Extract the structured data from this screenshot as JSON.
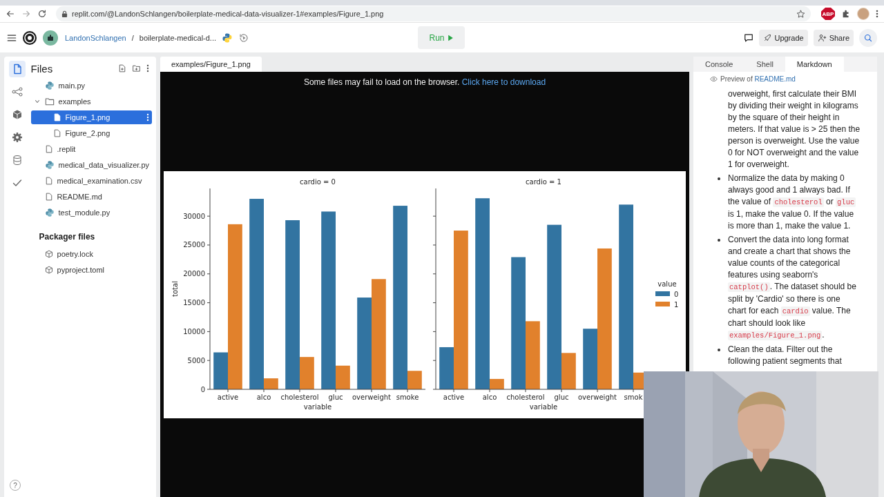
{
  "browser": {
    "url": "replit.com/@LandonSchlangen/boilerplate-medical-data-visualizer-1#examples/Figure_1.png",
    "extension_badge": "ABP"
  },
  "header": {
    "user": "LandonSchlangen",
    "separator": "/",
    "project": "boilerplate-medical-d...",
    "run_button": "Run",
    "upgrade_button": "Upgrade",
    "share_button": "Share"
  },
  "sidebar": {
    "rail": [
      {
        "kind": "files",
        "selected": true
      },
      {
        "kind": "version_control",
        "selected": false
      },
      {
        "kind": "packages",
        "selected": false
      },
      {
        "kind": "settings",
        "selected": false
      },
      {
        "kind": "database",
        "selected": false
      },
      {
        "kind": "tests",
        "selected": false
      }
    ],
    "title": "Files",
    "tree": [
      {
        "name": "main.py",
        "kind": "python",
        "selected": false
      },
      {
        "name": "examples",
        "kind": "folder",
        "selected": false,
        "expanded": true,
        "children": [
          {
            "name": "Figure_1.png",
            "kind": "file",
            "selected": true
          },
          {
            "name": "Figure_2.png",
            "kind": "file",
            "selected": false
          }
        ]
      },
      {
        "name": ".replit",
        "kind": "file",
        "selected": false
      },
      {
        "name": "medical_data_visualizer.py",
        "kind": "python",
        "selected": false
      },
      {
        "name": "medical_examination.csv",
        "kind": "file",
        "selected": false
      },
      {
        "name": "README.md",
        "kind": "file",
        "selected": false
      },
      {
        "name": "test_module.py",
        "kind": "python",
        "selected": false
      }
    ],
    "packager_title": "Packager files",
    "packager_files": [
      {
        "name": "poetry.lock",
        "kind": "package",
        "selected": false
      },
      {
        "name": "pyproject.toml",
        "kind": "package",
        "selected": false
      }
    ],
    "help": "?"
  },
  "editor": {
    "tab": "examples/Figure_1.png",
    "notice": "Some files may fail to load on the browser.",
    "notice_link": "Click here to download",
    "facets": [
      {
        "chart_data": {
          "type": "bar",
          "title": "cardio = 0",
          "xlabel": "variable",
          "ylabel": "total",
          "categories": [
            "active",
            "alco",
            "cholesterol",
            "gluc",
            "overweight",
            "smoke"
          ],
          "ylim": [
            0,
            34800
          ],
          "yticks": [
            0,
            5000,
            10000,
            15000,
            20000,
            25000,
            30000
          ],
          "series": [
            {
              "color": "#3274a1",
              "values": [
                6400,
                33000,
                29300,
                30800,
                15900,
                31800
              ]
            },
            {
              "color": "#e1812c",
              "values": [
                28600,
                1900,
                5600,
                4100,
                19100,
                3200
              ]
            }
          ]
        }
      },
      {
        "chart_data": {
          "type": "bar",
          "title": "cardio = 1",
          "xlabel": "variable",
          "categories": [
            "active",
            "alco",
            "cholesterol",
            "gluc",
            "overweight",
            "smok"
          ],
          "ylim": [
            0,
            34800
          ],
          "legend": {
            "title": "value"
          },
          "series": [
            {
              "name": "0",
              "color": "#3274a1",
              "values": [
                7300,
                33100,
                22900,
                28500,
                10500,
                32000
              ]
            },
            {
              "name": "1",
              "color": "#e1812c",
              "values": [
                27500,
                1800,
                11800,
                6300,
                24400,
                2900
              ]
            }
          ]
        }
      }
    ]
  },
  "right_panel": {
    "tabs": [
      {
        "label": "Console",
        "selected": false
      },
      {
        "label": "Shell",
        "selected": false
      },
      {
        "label": "Markdown",
        "selected": true
      }
    ],
    "preview_label": "Preview of",
    "preview_file": "README.md",
    "items": [
      {
        "kind": "continuation",
        "segments": [
          {
            "kind": "text",
            "text": "overweight, first calculate their BMI by dividing their weight in kilograms by the square of their height in meters. If that value is > 25 then the person is overweight. Use the value 0 for NOT overweight and the value 1 for overweight."
          }
        ]
      },
      {
        "kind": "bullet",
        "segments": [
          {
            "kind": "text",
            "text": "Normalize the data by making 0 always good and 1 always bad. If the value of "
          },
          {
            "kind": "code",
            "text": "cholesterol"
          },
          {
            "kind": "text",
            "text": " or "
          },
          {
            "kind": "code",
            "text": "gluc"
          },
          {
            "kind": "text",
            "text": " is 1, make the value 0. If the value is more than 1, make the value 1."
          }
        ]
      },
      {
        "kind": "bullet",
        "segments": [
          {
            "kind": "text",
            "text": "Convert the data into long format and create a chart that shows the value counts of the categorical features using seaborn's "
          },
          {
            "kind": "code",
            "text": "catplot()"
          },
          {
            "kind": "text",
            "text": ". The dataset should be split by 'Cardio' so there is one chart for each "
          },
          {
            "kind": "code",
            "text": "cardio"
          },
          {
            "kind": "text",
            "text": " value. The chart should look like "
          },
          {
            "kind": "code",
            "text": "examples/Figure_1.png"
          },
          {
            "kind": "text",
            "text": "."
          }
        ]
      },
      {
        "kind": "bullet",
        "segments": [
          {
            "kind": "text",
            "text": "Clean the data. Filter out the following patient segments that"
          }
        ]
      }
    ]
  }
}
